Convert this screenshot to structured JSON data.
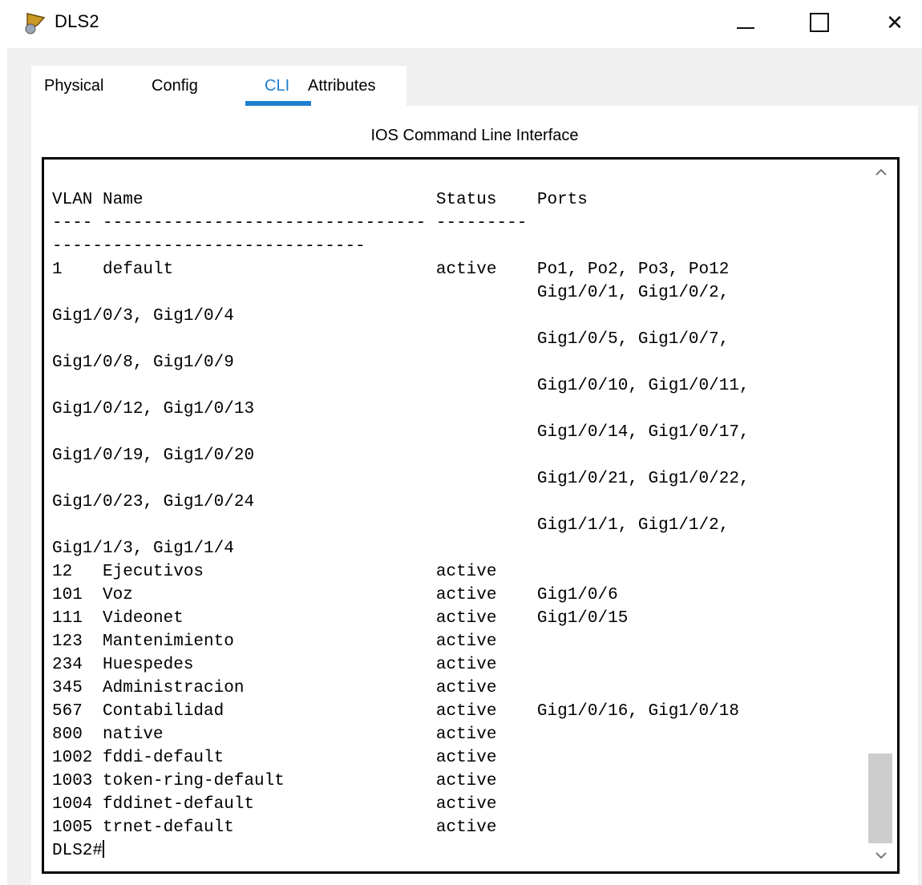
{
  "window": {
    "title": "DLS2",
    "minimize_glyph": "—",
    "close_glyph": "✕"
  },
  "tabs": [
    {
      "label": "Physical"
    },
    {
      "label": "Config"
    },
    {
      "label": "CLI",
      "active": true
    },
    {
      "label": "Attributes"
    }
  ],
  "section_title": "IOS Command Line Interface",
  "terminal": {
    "lines": [
      "VLAN Name                             Status    Ports",
      "---- -------------------------------- ---------",
      "-------------------------------",
      "1    default                          active    Po1, Po2, Po3, Po12",
      "                                                Gig1/0/1, Gig1/0/2,",
      "Gig1/0/3, Gig1/0/4",
      "                                                Gig1/0/5, Gig1/0/7,",
      "Gig1/0/8, Gig1/0/9",
      "                                                Gig1/0/10, Gig1/0/11,",
      "Gig1/0/12, Gig1/0/13",
      "                                                Gig1/0/14, Gig1/0/17,",
      "Gig1/0/19, Gig1/0/20",
      "                                                Gig1/0/21, Gig1/0/22,",
      "Gig1/0/23, Gig1/0/24",
      "                                                Gig1/1/1, Gig1/1/2,",
      "Gig1/1/3, Gig1/1/4",
      "12   Ejecutivos                       active",
      "101  Voz                              active    Gig1/0/6",
      "111  Videonet                         active    Gig1/0/15",
      "123  Mantenimiento                    active",
      "234  Huespedes                        active",
      "345  Administracion                   active",
      "567  Contabilidad                     active    Gig1/0/16, Gig1/0/18",
      "800  native                           active",
      "1002 fddi-default                     active",
      "1003 token-ring-default               active",
      "1004 fddinet-default                  active",
      "1005 trnet-default                    active"
    ],
    "prompt": "DLS2#"
  },
  "colors": {
    "accent": "#1e7fd0",
    "panel_bg": "#f0f0f0",
    "scroll_thumb": "#cdcdcd"
  },
  "icons": {
    "app": "packet-tracer-switch-icon",
    "scroll_up": "chevron-up-icon",
    "scroll_down": "chevron-down-icon"
  }
}
